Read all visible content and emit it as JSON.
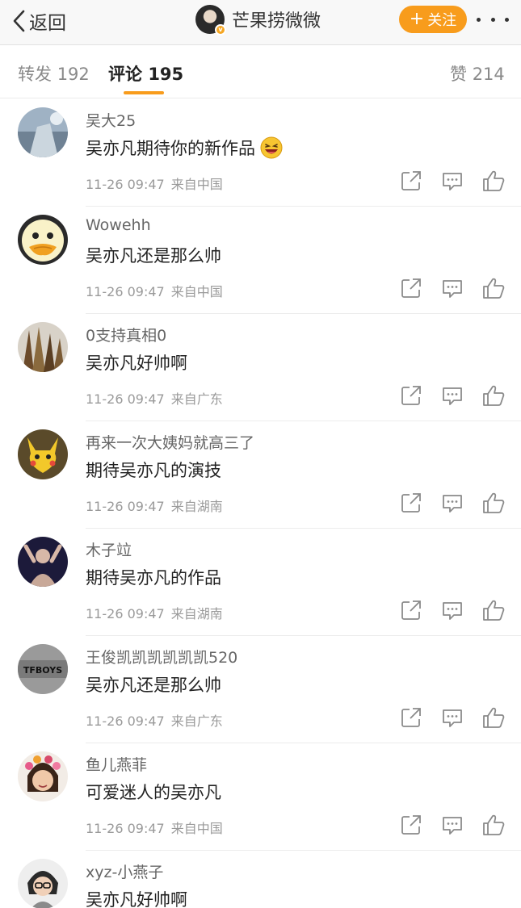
{
  "nav": {
    "back_label": "返回",
    "title": "芒果捞微微",
    "follow_label": "关注",
    "follow_plus": "+"
  },
  "tabs": {
    "repost": {
      "label": "转发",
      "count": "192"
    },
    "comment": {
      "label": "评论",
      "count": "195"
    },
    "like": {
      "label": "赞",
      "count": "214"
    }
  },
  "comments": [
    {
      "user": "吴大25",
      "text": "吴亦凡期待你的新作品",
      "emoji": "laughing-emoji",
      "time": "11-26 09:47",
      "source": "来自中国"
    },
    {
      "user": "Wowehh",
      "text": "吴亦凡还是那么帅",
      "time": "11-26 09:47",
      "source": "来自中国"
    },
    {
      "user": "0支持真相0",
      "text": "吴亦凡好帅啊",
      "time": "11-26 09:47",
      "source": "来自广东"
    },
    {
      "user": "再来一次大姨妈就高三了",
      "text": "期待吴亦凡的演技",
      "time": "11-26 09:47",
      "source": "来自湖南"
    },
    {
      "user": "木子竝",
      "text": "期待吴亦凡的作品",
      "time": "11-26 09:47",
      "source": "来自湖南"
    },
    {
      "user": "王俊凯凯凯凯凯凯520",
      "text": "吴亦凡还是那么帅",
      "time": "11-26 09:47",
      "source": "来自广东"
    },
    {
      "user": "鱼儿燕菲",
      "text": "可爱迷人的吴亦凡",
      "time": "11-26 09:47",
      "source": "来自中国"
    },
    {
      "user": "xyz-小燕子",
      "text": "吴亦凡好帅啊"
    }
  ],
  "avatar_text": {
    "tfboys": "TFBOYS"
  },
  "colors": {
    "accent": "#f89c1c",
    "meta": "#9a9a9a",
    "text": "#222222"
  }
}
